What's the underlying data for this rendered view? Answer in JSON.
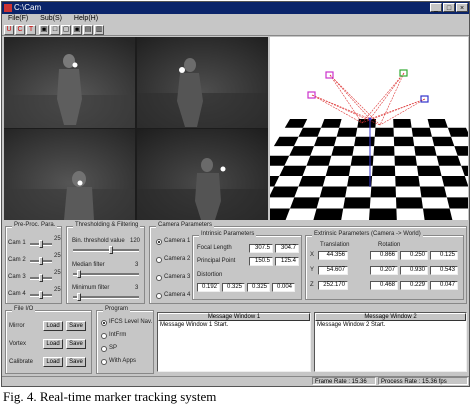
{
  "window": {
    "title": "C:\\Cam"
  },
  "menu": [
    "File(F)",
    "Sub(S)",
    "Help(H)"
  ],
  "toolbar": [
    "U",
    "C",
    "T",
    "▣",
    "□",
    "▢",
    "▣",
    "▤",
    "▥"
  ],
  "preprocess": {
    "title": "Pre-Proc. Para.",
    "rows": [
      {
        "label": "Cam 1",
        "value": "25"
      },
      {
        "label": "Cam 2",
        "value": "25"
      },
      {
        "label": "Cam 3",
        "value": "25"
      },
      {
        "label": "Cam 4",
        "value": "25"
      }
    ]
  },
  "threshold": {
    "title": "Thresholding & Filtering",
    "rows": [
      {
        "label": "Bin. threshold value",
        "value": "120"
      },
      {
        "label": "Median filter",
        "value": "3"
      },
      {
        "label": "Minimum filter",
        "value": "3"
      }
    ]
  },
  "camera_params": {
    "title": "Camera Parameters",
    "cameras": [
      "Camera 1",
      "Camera 2",
      "Camera 3",
      "Camera 4"
    ],
    "intrinsic": {
      "title": "Intrinsic Parameters",
      "focal_label": "Focal Length",
      "focal": [
        "307.5",
        "304.7"
      ],
      "principal_label": "Principal Point",
      "principal": [
        "150.5",
        "125.4"
      ],
      "distortion_label": "Distortion",
      "distortion": [
        "0.192",
        "0.325",
        "0.325",
        "0.004"
      ]
    },
    "extrinsic": {
      "title": "Extrinsic Parameters (Camera -> World)",
      "translation_label": "Translation",
      "rotation_label": "Rotation",
      "axes": [
        "X",
        "Y",
        "Z"
      ],
      "translation": [
        "44.356",
        "54.607",
        "252.170"
      ],
      "rotation": [
        [
          "0.866",
          "0.250",
          "0.125"
        ],
        [
          "0.207",
          "0.930",
          "0.543"
        ],
        [
          "0.468",
          "0.229",
          "0.047"
        ]
      ]
    }
  },
  "file_io": {
    "title": "File I/O",
    "rows": [
      {
        "label": "Mirror",
        "load": "Load",
        "save": "Save"
      },
      {
        "label": "Vortex",
        "load": "Load",
        "save": "Save"
      },
      {
        "label": "Calibrate",
        "load": "Load",
        "save": "Save"
      }
    ]
  },
  "program": {
    "title": "Program",
    "options": [
      "IFCS Level Nav.",
      "IntFrm",
      "SP",
      "With Apps"
    ],
    "selected": 0
  },
  "messages": [
    {
      "title": "Message Window 1",
      "text": "Message Window 1 Start."
    },
    {
      "title": "Message Window 2",
      "text": "Message Window 2 Start."
    }
  ],
  "status": {
    "left": "Frame Rate : 15.36 fps",
    "right": "Process Rate : 15.36 fps"
  },
  "caption": "Fig. 4. Real-time marker tracking system"
}
